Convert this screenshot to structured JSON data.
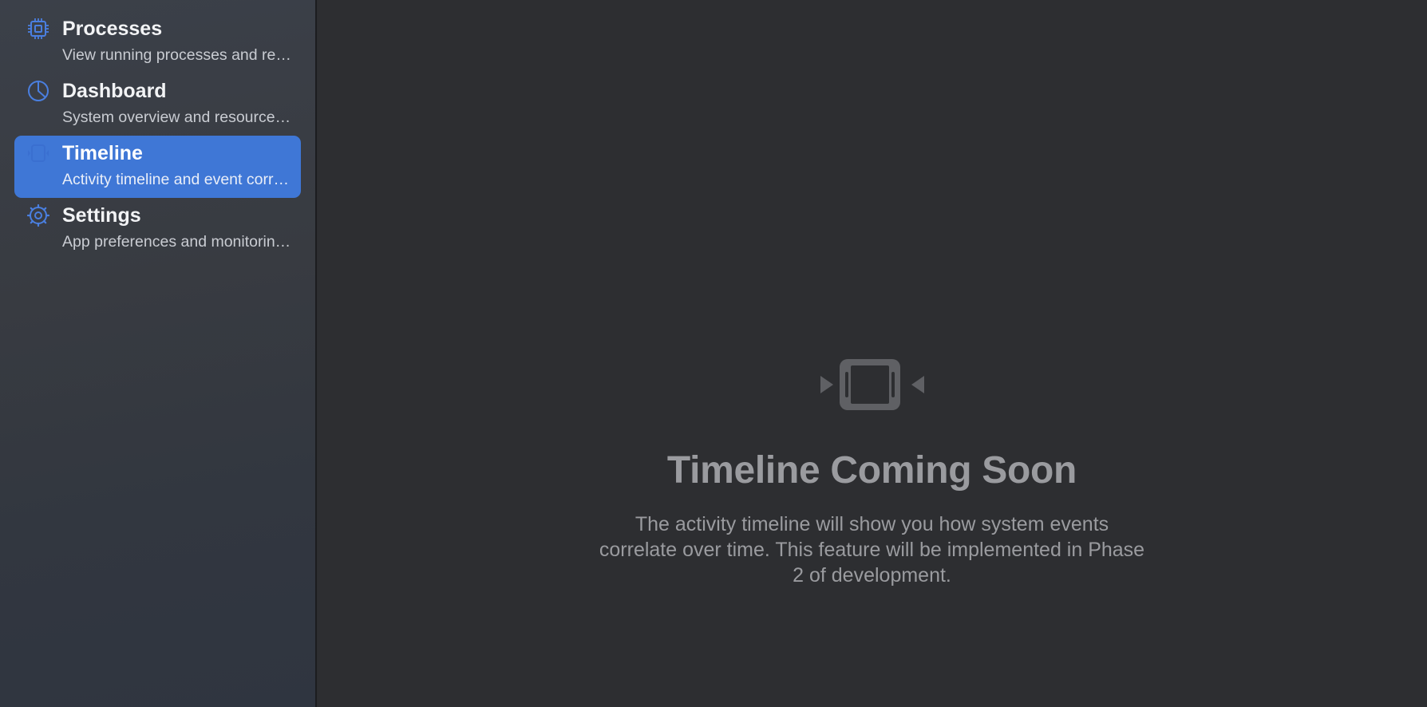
{
  "sidebar": {
    "items": [
      {
        "label": "Processes",
        "subtitle": "View running processes and resource usage",
        "icon": "cpu-icon",
        "active": false
      },
      {
        "label": "Dashboard",
        "subtitle": "System overview and resource monitoring",
        "icon": "chart-pie-icon",
        "active": false
      },
      {
        "label": "Timeline",
        "subtitle": "Activity timeline and event correlation",
        "icon": "timeline-icon",
        "active": true
      },
      {
        "label": "Settings",
        "subtitle": "App preferences and monitoring options",
        "icon": "gear-icon",
        "active": false
      }
    ]
  },
  "main": {
    "icon": "timeline-placeholder-icon",
    "title": "Timeline Coming Soon",
    "description": "The activity timeline will show you how system events correlate over time. This feature will be implemented in Phase 2 of development."
  },
  "colors": {
    "accent": "#3f77d6",
    "icon_blue": "#4a7fe0",
    "muted_text": "#9a9b9f"
  }
}
